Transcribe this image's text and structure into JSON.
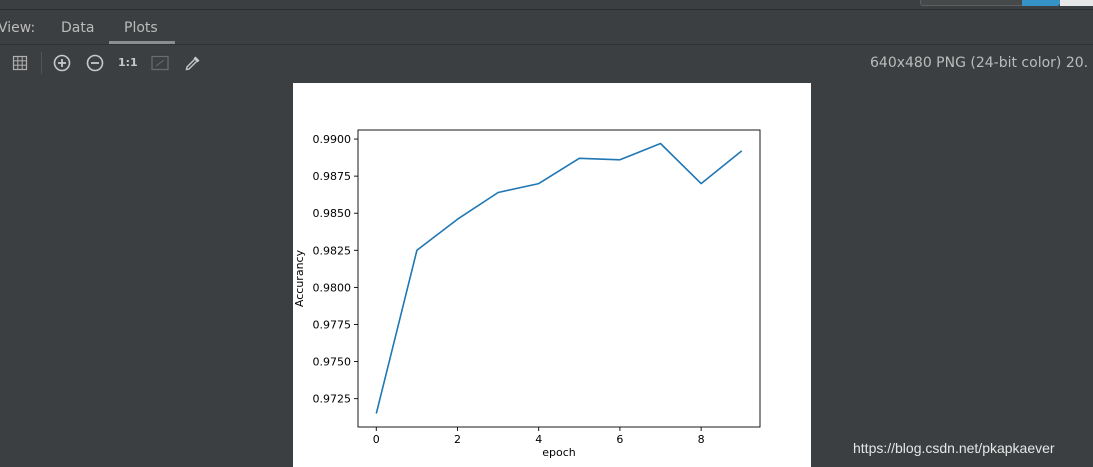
{
  "header": {
    "view_label": "View:",
    "tabs": [
      {
        "label": "Data",
        "active": false
      },
      {
        "label": "Plots",
        "active": true
      }
    ]
  },
  "toolbar": {
    "icons": [
      "grid-icon",
      "zoom-in-icon",
      "zoom-out-icon",
      "actual-size-icon",
      "fit-icon",
      "eyedropper-icon"
    ],
    "actual_size_label": "1:1",
    "image_info": "640x480 PNG (24-bit color) 20."
  },
  "colors": {
    "background": "#3c3f41",
    "line": "#1f77b4",
    "plot_bg": "#ffffff"
  },
  "watermark": "https://blog.csdn.net/pkapkaever",
  "chart_data": {
    "type": "line",
    "title": "",
    "xlabel": "epoch",
    "ylabel": "Accurancy",
    "x": [
      0,
      1,
      2,
      3,
      4,
      5,
      6,
      7,
      8,
      9
    ],
    "series": [
      {
        "values": [
          0.9715,
          0.9825,
          0.9846,
          0.9864,
          0.987,
          0.9887,
          0.9886,
          0.9897,
          0.987,
          0.9892
        ]
      }
    ],
    "xticks": [
      0,
      2,
      4,
      6,
      8
    ],
    "xtick_labels": [
      "0",
      "2",
      "4",
      "6",
      "8"
    ],
    "yticks": [
      0.9725,
      0.975,
      0.9775,
      0.98,
      0.9825,
      0.985,
      0.9875,
      0.99
    ],
    "ytick_labels": [
      "0.9725",
      "0.9750",
      "0.9775",
      "0.9800",
      "0.9825",
      "0.9850",
      "0.9875",
      "0.9900"
    ],
    "xlim": [
      -0.45,
      9.45
    ],
    "ylim": [
      0.97059,
      0.99061
    ],
    "grid": false,
    "legend": false
  }
}
